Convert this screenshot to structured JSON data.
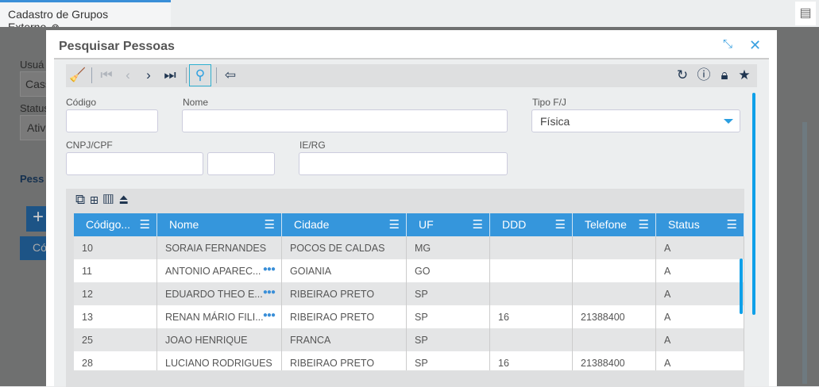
{
  "tab": {
    "title": "Cadastro de Grupos Externo",
    "close_icon": "circle-x-icon"
  },
  "background": {
    "usuario_label": "Usuá",
    "usuario_value": "Cass",
    "status_label": "Status",
    "status_value": "Ativ",
    "section": "Pess",
    "col": "Có"
  },
  "modal": {
    "title": "Pesquisar Pessoas"
  },
  "form": {
    "codigo_label": "Código",
    "codigo_value": "",
    "nome_label": "Nome",
    "nome_value": "",
    "tipo_label": "Tipo F/J",
    "tipo_value": "Física",
    "cnpj_label": "CNPJ/CPF",
    "cnpj_value": "",
    "cnpj2_value": "",
    "ie_label": "IE/RG",
    "ie_value": ""
  },
  "table": {
    "columns": [
      "Código...",
      "Nome",
      "Cidade",
      "UF",
      "DDD",
      "Telefone",
      "Status"
    ],
    "rows": [
      [
        "10",
        "SORAIA FERNANDES",
        "POCOS DE CALDAS",
        "MG",
        "",
        "",
        "A"
      ],
      [
        "11",
        "ANTONIO APAREC...",
        "GOIANIA",
        "GO",
        "",
        "",
        "A"
      ],
      [
        "12",
        "EDUARDO THEO E...",
        "RIBEIRAO PRETO",
        "SP",
        "",
        "",
        "A"
      ],
      [
        "13",
        "RENAN MÁRIO FILI...",
        "RIBEIRAO PRETO",
        "SP",
        "16",
        "21388400",
        "A"
      ],
      [
        "25",
        "JOAO HENRIQUE",
        "FRANCA",
        "SP",
        "",
        "",
        "A"
      ],
      [
        "28",
        "LUCIANO RODRIGUES",
        "RIBEIRAO PRETO",
        "SP",
        "16",
        "21388400",
        "A"
      ]
    ],
    "truncated": [
      false,
      true,
      true,
      true,
      false,
      false
    ]
  },
  "colors": {
    "accent": "#3596dc",
    "scroll": "#0fa0e8"
  }
}
